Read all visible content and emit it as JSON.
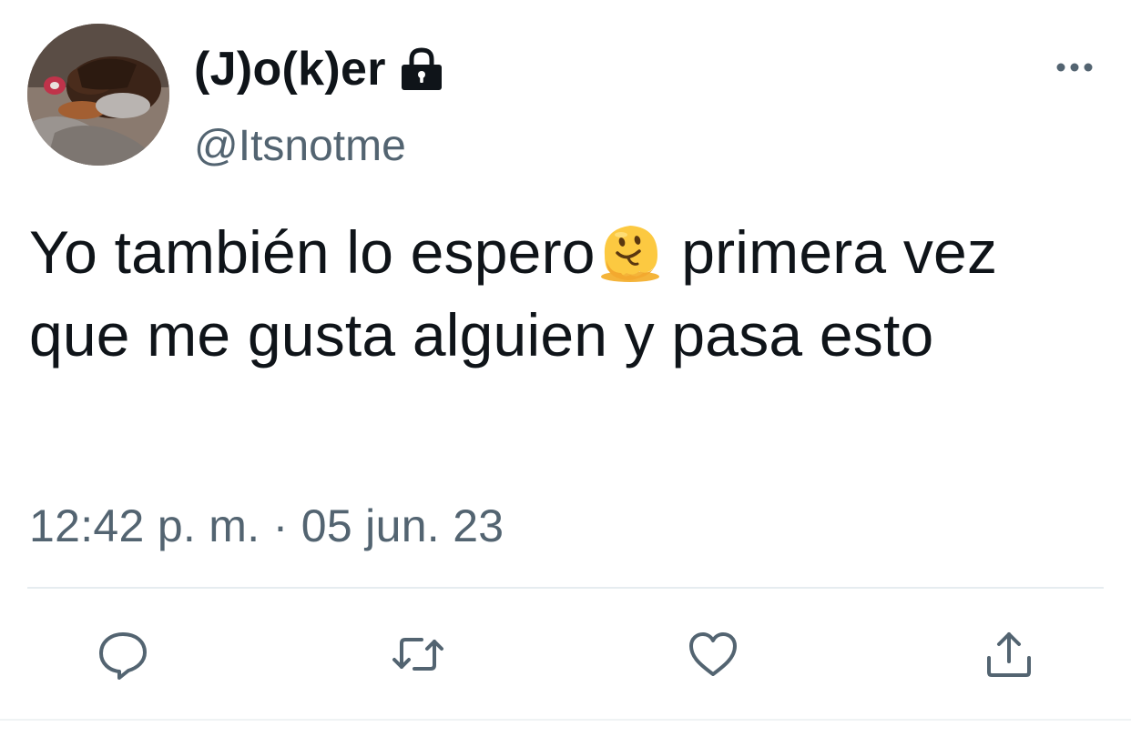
{
  "tweet": {
    "display_name": "(J)o(k)er",
    "handle": "@Itsnotme",
    "text_part1": "Yo también lo espero",
    "text_part2": " primera vez que me gusta alguien y pasa esto",
    "emoji": "melting-face-icon",
    "timestamp": "12:42 p. m. · 05 jun. 23",
    "protected": true
  },
  "actions": {
    "reply": "reply-icon",
    "retweet": "retweet-icon",
    "like": "heart-icon",
    "share": "share-icon"
  },
  "colors": {
    "text": "#0f1419",
    "secondary": "#536471",
    "divider": "#e6ecf0",
    "icon": "#536471"
  }
}
